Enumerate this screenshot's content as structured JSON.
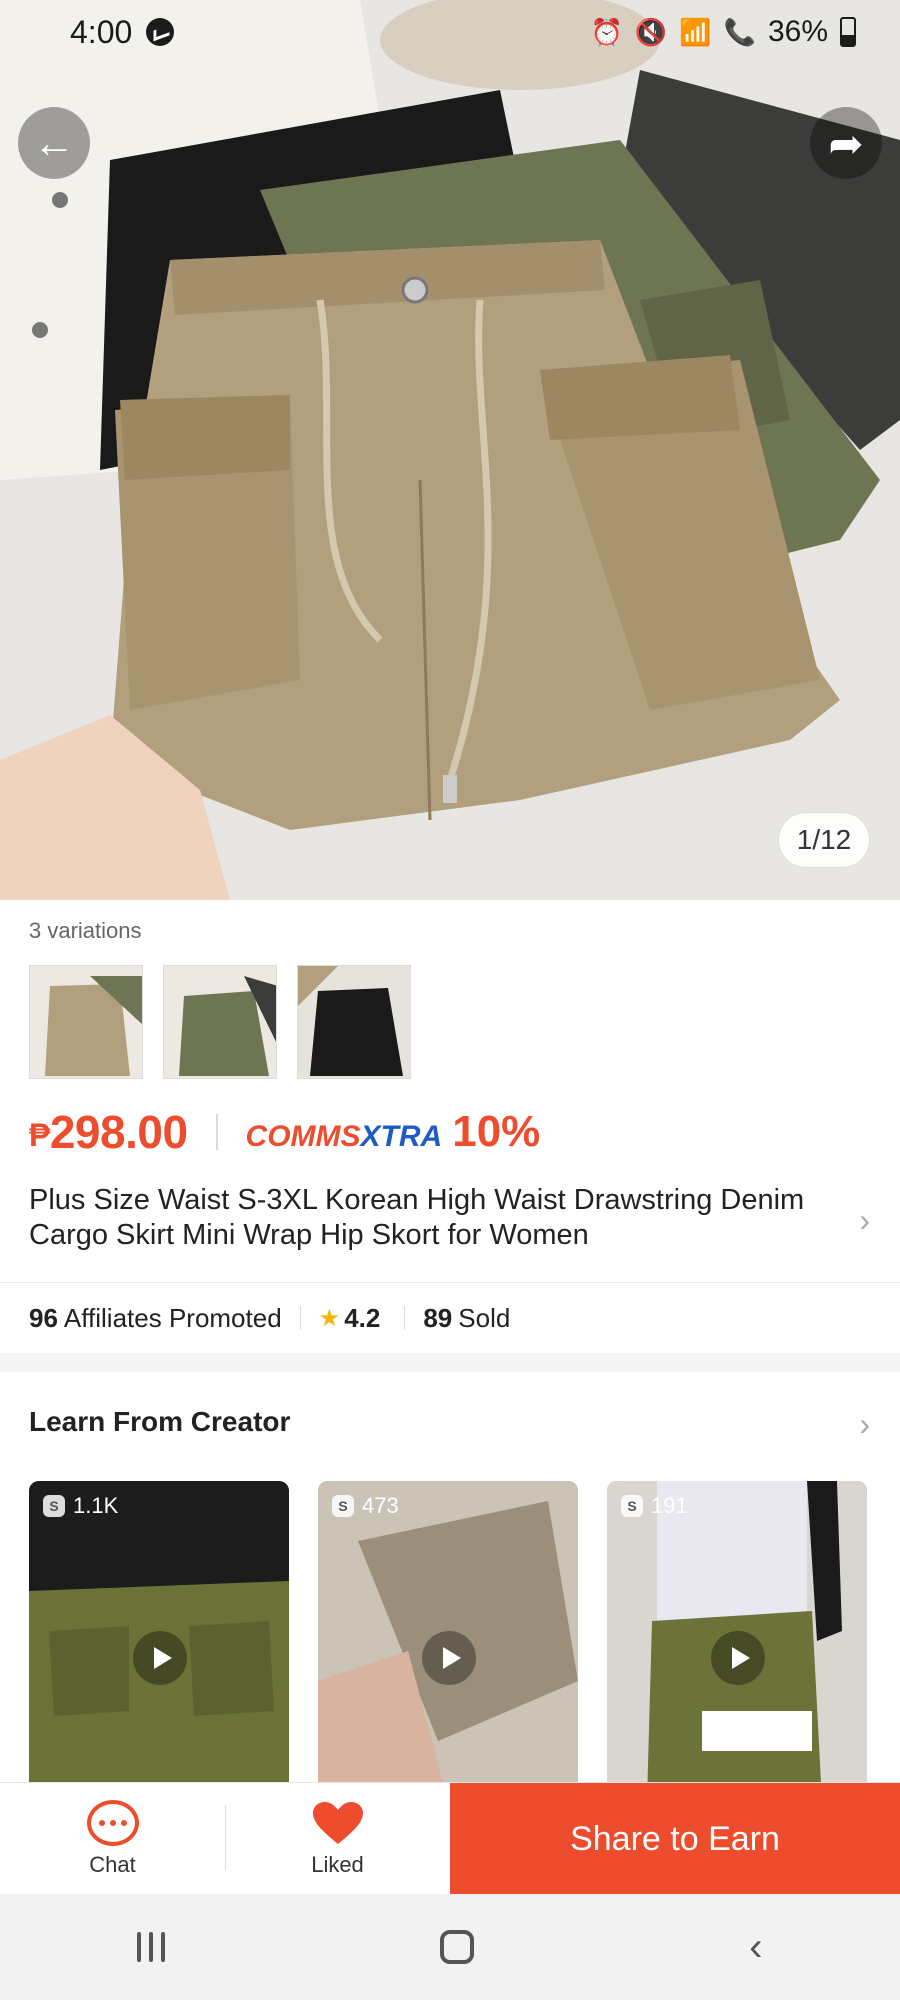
{
  "status_bar": {
    "time": "4:00",
    "battery": "36%"
  },
  "hero": {
    "image_counter": "1/12"
  },
  "product": {
    "variations_label": "3 variations",
    "variations": [
      {
        "name": "khaki"
      },
      {
        "name": "army-green"
      },
      {
        "name": "black"
      }
    ],
    "currency": "₱",
    "price": "298.00",
    "comms_brand_a": "COMMS",
    "comms_brand_b": "XTRA",
    "comms_percent": "10%",
    "title": "Plus Size Waist S-3XL Korean High Waist Drawstring Denim Cargo Skirt Mini Wrap Hip Skort for Women"
  },
  "stats": {
    "affiliates_count": "96",
    "affiliates_label": "Affiliates Promoted",
    "rating": "4.2",
    "sold_count": "89",
    "sold_label": "Sold"
  },
  "creator": {
    "title": "Learn From Creator",
    "videos": [
      {
        "count": "1.1K"
      },
      {
        "count": "473"
      },
      {
        "count": "191"
      }
    ]
  },
  "actions": {
    "chat_label": "Chat",
    "liked_label": "Liked",
    "share_label": "Share to Earn"
  },
  "colors": {
    "accent": "#ee4d2d",
    "comms_blue": "#1e5bc6",
    "star": "#f5b50a"
  }
}
